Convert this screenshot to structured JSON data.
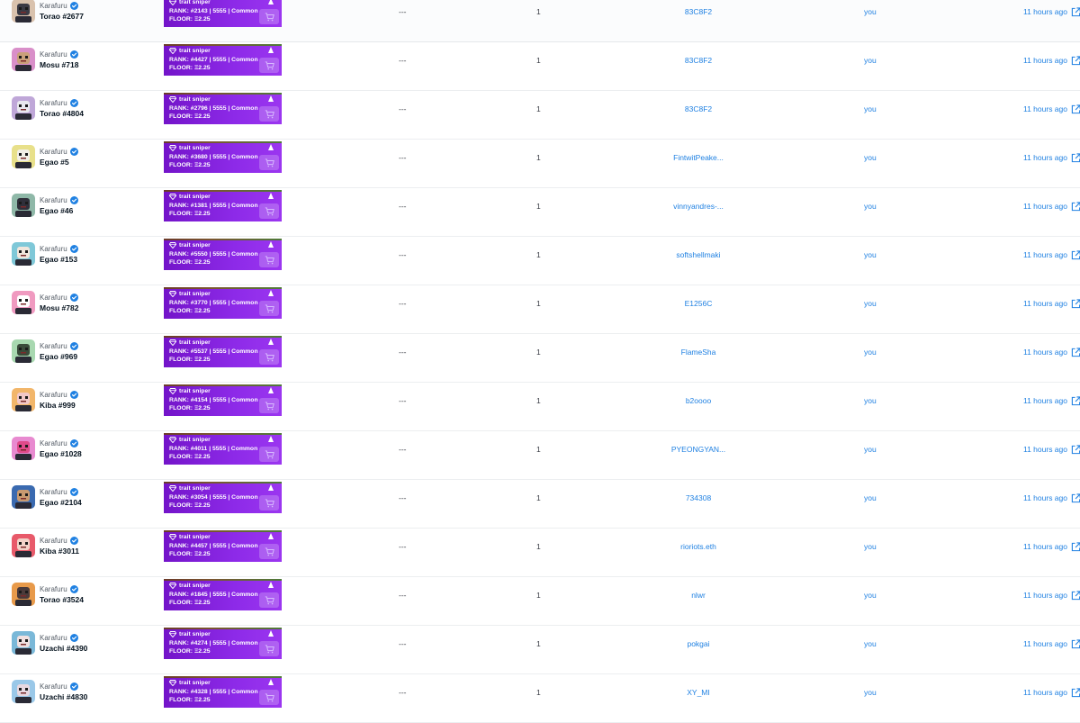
{
  "collection_name": "Karafuru",
  "price_placeholder": "---",
  "to_label": "you",
  "time_label": "11 hours ago",
  "trait_sniper": {
    "title": "trait sniper",
    "rank_prefix": "RANK:",
    "floor_prefix": "FLOOR:",
    "floor_value": "Ξ2.25",
    "total_supply": "5555",
    "rarity": "Common"
  },
  "rows": [
    {
      "name": "Torao #2677",
      "rank_line": "RANK:  #2143 | 5555 | Common",
      "floor_line": "FLOOR:  Ξ2.25",
      "quantity": "1",
      "from": "83C8F2",
      "avatar_bg": "#d9c2ad",
      "avatar_fg": "#3a3a44"
    },
    {
      "name": "Mosu #718",
      "rank_line": "RANK:  #4427 | 5555 | Common",
      "floor_line": "FLOOR:  Ξ2.25",
      "quantity": "1",
      "from": "83C8F2",
      "avatar_bg": "#d98fc9",
      "avatar_fg": "#c9a07a"
    },
    {
      "name": "Torao #4804",
      "rank_line": "RANK:  #2796 | 5555 | Common",
      "floor_line": "FLOOR:  Ξ2.25",
      "quantity": "1",
      "from": "83C8F2",
      "avatar_bg": "#bfa7d8",
      "avatar_fg": "#e8e8ee"
    },
    {
      "name": "Egao #5",
      "rank_line": "RANK:  #3680 | 5555 | Common",
      "floor_line": "FLOOR:  Ξ2.25",
      "quantity": "1",
      "from": "FintwitPeake...",
      "avatar_bg": "#e8e08a",
      "avatar_fg": "#f2efe6"
    },
    {
      "name": "Egao #46",
      "rank_line": "RANK:  #1381 | 5555 | Common",
      "floor_line": "FLOOR:  Ξ2.25",
      "quantity": "1",
      "from": "vinnyandres-...",
      "avatar_bg": "#8fb8a8",
      "avatar_fg": "#2f2f3a"
    },
    {
      "name": "Egao #153",
      "rank_line": "RANK:  #5550 | 5555 | Common",
      "floor_line": "FLOOR:  Ξ2.25",
      "quantity": "1",
      "from": "softshellmaki",
      "avatar_bg": "#7fc8d8",
      "avatar_fg": "#f0e6dc"
    },
    {
      "name": "Mosu #782",
      "rank_line": "RANK:  #3770 | 5555 | Common",
      "floor_line": "FLOOR:  Ξ2.25",
      "quantity": "1",
      "from": "E1256C",
      "avatar_bg": "#f09ac0",
      "avatar_fg": "#ffffff"
    },
    {
      "name": "Egao #969",
      "rank_line": "RANK:  #5537 | 5555 | Common",
      "floor_line": "FLOOR:  Ξ2.25",
      "quantity": "1",
      "from": "FlameSha",
      "avatar_bg": "#a8d8b0",
      "avatar_fg": "#3a4a3a"
    },
    {
      "name": "Kiba #999",
      "rank_line": "RANK:  #4154 | 5555 | Common",
      "floor_line": "FLOOR:  Ξ2.25",
      "quantity": "1",
      "from": "b2oooo",
      "avatar_bg": "#f2b66a",
      "avatar_fg": "#f2c8c8"
    },
    {
      "name": "Egao #1028",
      "rank_line": "RANK:  #4011 | 5555 | Common",
      "floor_line": "FLOOR:  Ξ2.25",
      "quantity": "1",
      "from": "PYEONGYAN...",
      "avatar_bg": "#e88ad0",
      "avatar_fg": "#e04a8a"
    },
    {
      "name": "Egao #2104",
      "rank_line": "RANK:  #3054 | 5555 | Common",
      "floor_line": "FLOOR:  Ξ2.25",
      "quantity": "1",
      "from": "734308",
      "avatar_bg": "#3a6ab0",
      "avatar_fg": "#c89a70"
    },
    {
      "name": "Kiba #3011",
      "rank_line": "RANK:  #4457 | 5555 | Common",
      "floor_line": "FLOOR:  Ξ2.25",
      "quantity": "1",
      "from": "rioriots.eth",
      "avatar_bg": "#e85a6a",
      "avatar_fg": "#f2d2c8"
    },
    {
      "name": "Torao #3524",
      "rank_line": "RANK:  #1845 | 5555 | Common",
      "floor_line": "FLOOR:  Ξ2.25",
      "quantity": "1",
      "from": "nlwr",
      "avatar_bg": "#e89a4a",
      "avatar_fg": "#4a3a3a"
    },
    {
      "name": "Uzachi #4390",
      "rank_line": "RANK:  #4274 | 5555 | Common",
      "floor_line": "FLOOR:  Ξ2.25",
      "quantity": "1",
      "from": "pokgai",
      "avatar_bg": "#7ab8d8",
      "avatar_fg": "#f0e0e0"
    },
    {
      "name": "Uzachi #4830",
      "rank_line": "RANK:  #4328 | 5555 | Common",
      "floor_line": "FLOOR:  Ξ2.25",
      "quantity": "1",
      "from": "XY_MI",
      "avatar_bg": "#9ac8e8",
      "avatar_fg": "#e8d8e0"
    }
  ]
}
